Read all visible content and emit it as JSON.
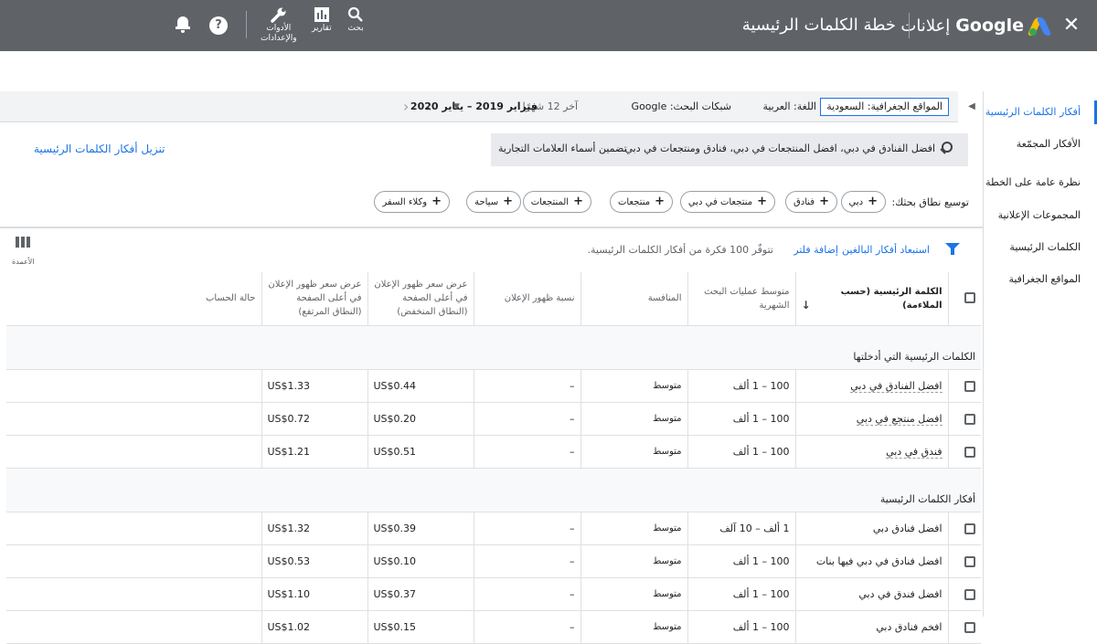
{
  "topbar": {
    "brand_google": "Google",
    "brand_ads": "إعلانات",
    "page_title": "خطة الكلمات الرئيسية",
    "search_label": "بحث",
    "reports_label": "تقارير",
    "tools_label_1": "الأدوات",
    "tools_label_2": "والإعدادات",
    "help_glyph": "?",
    "close_glyph": "✕"
  },
  "sidebar": {
    "items": [
      {
        "label": "أفكار الكلمات الرئيسية",
        "active": true
      },
      {
        "label": "الأفكار المجمّعة"
      },
      {
        "label": "نظرة عامة على الخطة"
      },
      {
        "label": "المجموعات الإعلانية"
      },
      {
        "label": "الكلمات الرئيسية"
      },
      {
        "label": "المواقع الجغرافية"
      }
    ]
  },
  "filters": {
    "locations": "المواقع الجغرافية: السعودية",
    "language": "اللغة: العربية",
    "networks": "شبكات البحث: Google",
    "range_label": "آخر 12 شهرًا",
    "date_range": "فبراير 2019 – يناير 2020"
  },
  "search": {
    "query": "افضل الفنادق في دبي، افضل المنتجعات في دبي، فنادق ومنتجعات في دبي",
    "brand_toggle": "تضمين أسماء العلامات التجارية",
    "download": "تنزيل أفكار الكلمات الرئيسية"
  },
  "broaden": {
    "label": "توسيع نطاق بحثك:",
    "chips": [
      "دبي",
      "فنادق",
      "منتجعات في دبي",
      "منتجعات",
      "المنتجعات",
      "سياحة",
      "وكلاء السفر"
    ]
  },
  "toolbar": {
    "exclude_adult": "استبعاد أفكار البالغين",
    "add_filter": "إضافة فلتر",
    "ideas_count": "تتوفّر 100 فكرة من أفكار الكلمات الرئيسية.",
    "columns_label": "الأعمدة"
  },
  "table": {
    "headers": {
      "keyword": "الكلمة الرئيسية (حسب الملاءمة)",
      "volume": "متوسط عمليات البحث الشهرية",
      "competition": "المنافسة",
      "impr_share": "نسبة ظهور الإعلان",
      "bid_low": "عرض سعر ظهور الإعلان في أعلى الصفحة (النطاق المنخفض)",
      "bid_high": "عرض سعر ظهور الإعلان في أعلى الصفحة (النطاق المرتفع)",
      "account_status": "حالة الحساب"
    },
    "section_entered": "الكلمات الرئيسية التي أدخلتها",
    "entered_rows": [
      {
        "keyword": "افضل الفنادق في دبي",
        "volume": "100 – 1 ألف",
        "competition": "متوسط",
        "impr": "–",
        "low": "US$0.44",
        "high": "US$1.33"
      },
      {
        "keyword": "افضل منتجع في دبي",
        "volume": "100 – 1 ألف",
        "competition": "متوسط",
        "impr": "–",
        "low": "US$0.20",
        "high": "US$0.72"
      },
      {
        "keyword": "فندق في دبي",
        "volume": "100 – 1 ألف",
        "competition": "متوسط",
        "impr": "–",
        "low": "US$0.51",
        "high": "US$1.21"
      }
    ],
    "section_ideas": "أفكار الكلمات الرئيسية",
    "idea_rows": [
      {
        "keyword": "افضل فنادق دبي",
        "volume": "1 ألف – 10 آلف",
        "competition": "متوسط",
        "impr": "–",
        "low": "US$0.39",
        "high": "US$1.32"
      },
      {
        "keyword": "افضل فنادق في دبي فيها بنات",
        "volume": "100 – 1 ألف",
        "competition": "متوسط",
        "impr": "–",
        "low": "US$0.10",
        "high": "US$0.53"
      },
      {
        "keyword": "افضل فندق في دبي",
        "volume": "100 – 1 ألف",
        "competition": "متوسط",
        "impr": "–",
        "low": "US$0.37",
        "high": "US$1.10"
      },
      {
        "keyword": "افخم فنادق دبي",
        "volume": "100 – 1 ألف",
        "competition": "متوسط",
        "impr": "–",
        "low": "US$0.15",
        "high": "US$1.02"
      }
    ]
  }
}
